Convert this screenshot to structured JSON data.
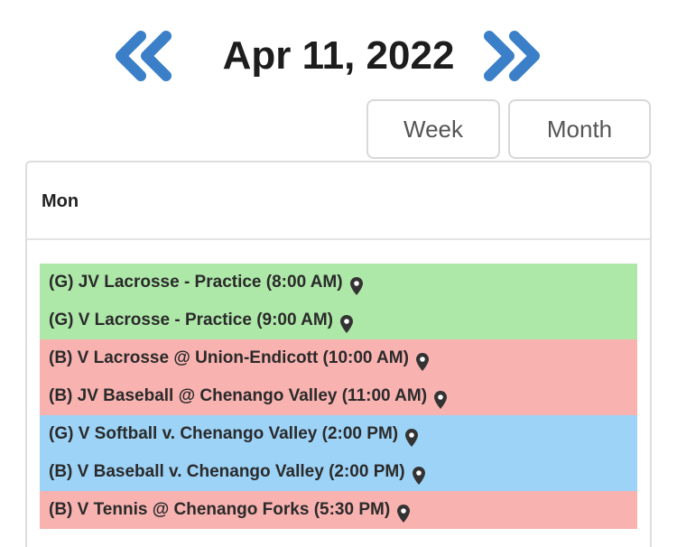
{
  "header": {
    "date_title": "Apr 11, 2022",
    "prev_icon": "double-chevron-left-icon",
    "next_icon": "double-chevron-right-icon",
    "arrow_color": "#3a7fc8"
  },
  "views": {
    "week_label": "Week",
    "month_label": "Month"
  },
  "day": {
    "label": "Mon",
    "events": [
      {
        "title": "(G) JV Lacrosse - Practice (8:00 AM)",
        "color": "#aee8a9",
        "icon": "map-pin-icon"
      },
      {
        "title": "(G) V Lacrosse - Practice (9:00 AM)",
        "color": "#aee8a9",
        "icon": "map-pin-icon"
      },
      {
        "title": "(B) V Lacrosse @ Union-Endicott (10:00 AM)",
        "color": "#f8b3b1",
        "icon": "map-pin-icon"
      },
      {
        "title": "(B) JV Baseball @ Chenango Valley (11:00 AM)",
        "color": "#f8b3b1",
        "icon": "map-pin-icon"
      },
      {
        "title": "(G) V Softball v. Chenango Valley (2:00 PM)",
        "color": "#9dd3f7",
        "icon": "map-pin-icon"
      },
      {
        "title": "(B) V Baseball v. Chenango Valley (2:00 PM)",
        "color": "#9dd3f7",
        "icon": "map-pin-icon"
      },
      {
        "title": "(B) V Tennis @ Chenango Forks (5:30 PM)",
        "color": "#f8b3b1",
        "icon": "map-pin-icon"
      }
    ]
  }
}
